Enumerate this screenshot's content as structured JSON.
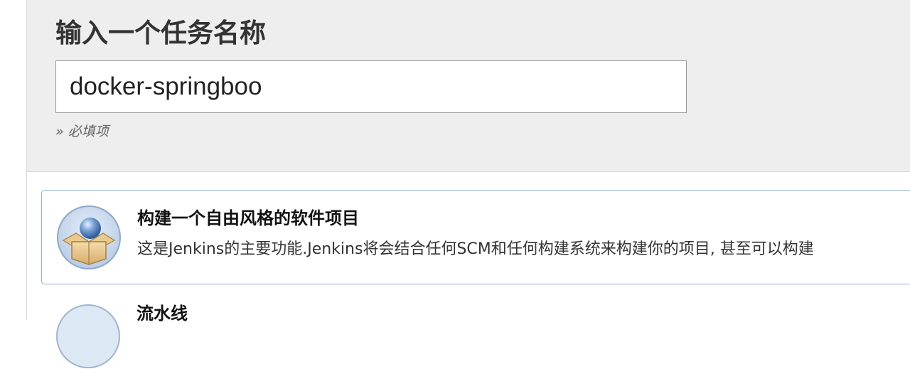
{
  "header": {
    "title": "输入一个任务名称",
    "name_input_value": "docker-springboo",
    "required_hint": "» 必填项"
  },
  "items": [
    {
      "title": "构建一个自由风格的软件项目",
      "description": "这是Jenkins的主要功能.Jenkins将会结合任何SCM和任何构建系统来构建你的项目, 甚至可以构建",
      "icon": "freestyle-project-box-icon",
      "selected": true
    },
    {
      "title": "流水线",
      "icon": "pipeline-icon",
      "selected": false
    }
  ],
  "colors": {
    "header_bg": "#eeeeee",
    "selected_border": "#8fb0d6"
  }
}
